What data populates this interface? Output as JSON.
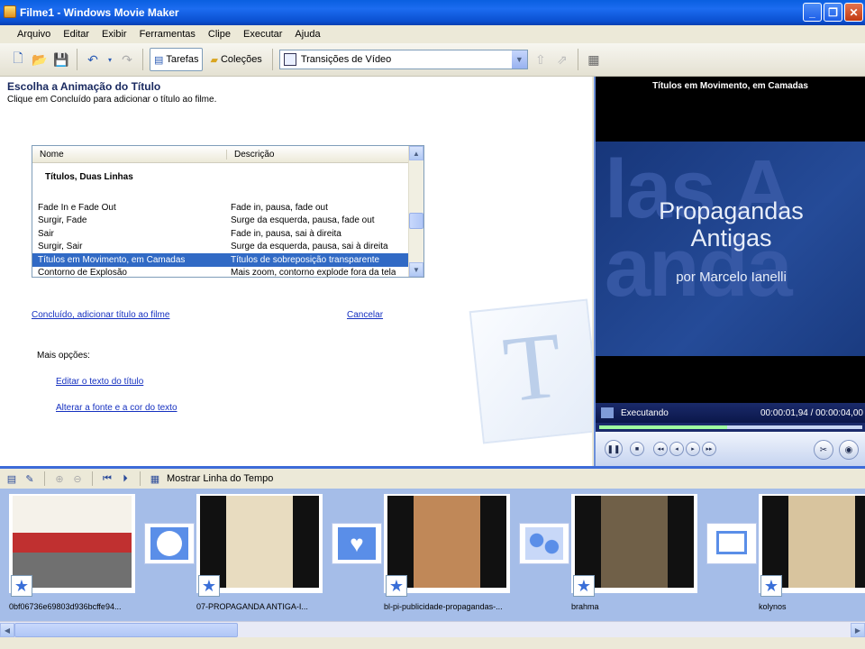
{
  "window": {
    "title": "Filme1 - Windows Movie Maker"
  },
  "menu": [
    "Arquivo",
    "Editar",
    "Exibir",
    "Ferramentas",
    "Clipe",
    "Executar",
    "Ajuda"
  ],
  "toolbar": {
    "tasks_label": "Tarefas",
    "collections_label": "Coleções",
    "collection_select": "Transições de Vídeo"
  },
  "task": {
    "title": "Escolha a Animação do Título",
    "subtitle": "Clique em Concluído para adicionar o título ao filme.",
    "columns": [
      "Nome",
      "Descrição"
    ],
    "group": "Títulos, Duas Linhas",
    "rows": [
      {
        "name": "Fade In e Fade Out",
        "desc": "Fade in, pausa, fade out"
      },
      {
        "name": "Surgir, Fade",
        "desc": "Surge da esquerda, pausa, fade out"
      },
      {
        "name": "Sair",
        "desc": "Fade in, pausa, sai à direita"
      },
      {
        "name": "Surgir, Sair",
        "desc": "Surge da esquerda, pausa, sai à direita"
      },
      {
        "name": "Títulos em Movimento, em Camadas",
        "desc": "Títulos de sobreposição transparente"
      },
      {
        "name": "Contorno de Explosão",
        "desc": "Mais zoom, contorno explode fora da tela"
      }
    ],
    "done_link": "Concluído, adicionar título ao filme",
    "cancel_link": "Cancelar",
    "more_options": "Mais opções:",
    "edit_text_link": "Editar o texto do título",
    "change_font_link": "Alterar a fonte e a cor do texto",
    "big_icon_letter": "T"
  },
  "preview": {
    "header": "Títulos em Movimento, em Camadas",
    "bg_text": "las A anda",
    "title": "Propagandas Antigas",
    "author": "por Marcelo Ianelli",
    "status": "Executando",
    "time": "00:00:01,94 / 00:00:04,00",
    "progress": 0.485
  },
  "storyboard": {
    "toggle_label": "Mostrar Linha do Tempo",
    "clips": [
      {
        "label": "0bf06736e69803d936bcffe94...",
        "color": "#c8b8a0"
      },
      {
        "label": "07-PROPAGANDA ANTIGA-I...",
        "color": "#d8c07a"
      },
      {
        "label": "bl-pi-publicidade-propagandas-...",
        "color": "#c09060"
      },
      {
        "label": "brahma",
        "color": "#806a50"
      },
      {
        "label": "kolynos",
        "color": "#d8c4a0"
      }
    ]
  },
  "colors": {
    "accent": "#316ac5",
    "link": "#1530c0"
  }
}
